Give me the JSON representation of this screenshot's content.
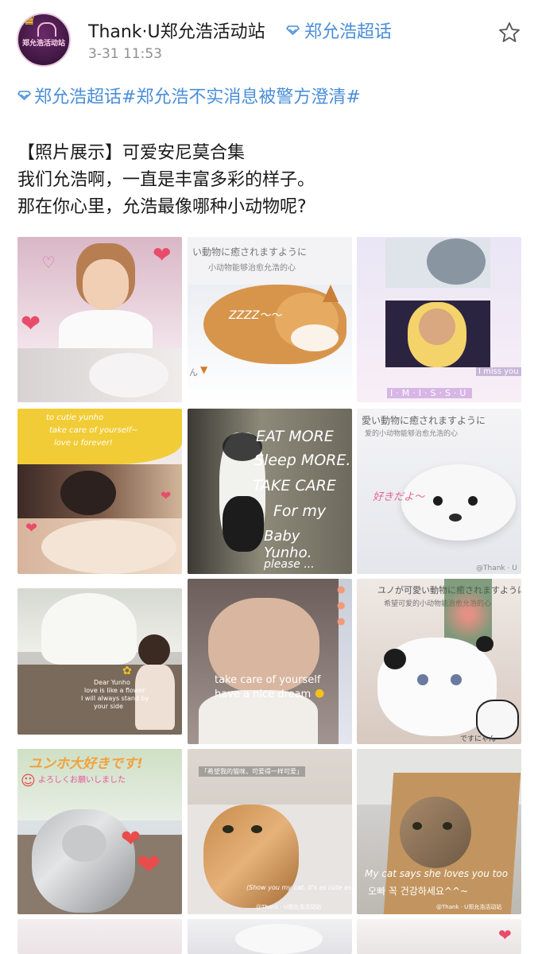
{
  "post": {
    "author": "Thank·U郑允浩活动站",
    "super_topic": "郑允浩超话",
    "time": "3-31 11:53",
    "topic_line": "郑允浩超话#郑允浩不实消息被警方澄清#",
    "body_lines": [
      "【照片展示】可爱安尼莫合集",
      "我们允浩啊，一直是丰富多彩的样子。",
      "那在你心里，允浩最像哪种小动物呢?"
    ],
    "icons": {
      "avatar": "avatar-crown-bunny",
      "star": "star-outline-icon",
      "super_topic": "diamond-icon"
    },
    "avatar_text": "郑允浩活动站"
  },
  "photos": {
    "p2": {
      "jp": "い動物に癒されますように",
      "cn": "小动物能够治愈允浩的心",
      "zzz": "ZZZZ～～",
      "tag": "ん"
    },
    "p3": {
      "miss": "I miss you",
      "letters": "I·M·I·S·S·U"
    },
    "p4": {
      "lines": [
        "to cutie yunho",
        "take care of yourself~",
        "love u forever!"
      ]
    },
    "p5": {
      "lines": [
        "EAT MORE",
        "Sleep MORE.",
        "TAKE CARE",
        "For my",
        "Baby Yunho.",
        "please ..."
      ]
    },
    "p6": {
      "jp": "愛い動物に癒されますように",
      "cn": "爱的小动物能够治愈允浩的心",
      "side": "好きだよ～",
      "wm": "@Thank · U"
    },
    "p7": {
      "lines": [
        "Dear Yunho",
        "love is like a flower",
        "I will always stand by",
        "your side"
      ]
    },
    "p8": {
      "lines": [
        "take care of yourself",
        "have a nice dream"
      ]
    },
    "p9": {
      "jp": "ユノが可愛い動物に癒されますように",
      "cn": "希望可爱的小动物能治愈允浩的心",
      "bottom": "ですにゃん"
    },
    "p10": {
      "top": "ユンホ大好きです!",
      "sub": "よろしくお願いしました"
    },
    "p11": {
      "top": "「希望我的猫咪，可爱得一样可爱」",
      "caption": "(Show you my cat, it's as cute as you.)",
      "wm": "@Thank · U郑允浩活动站"
    },
    "p12": {
      "line1": "My cat says she loves you too",
      "line2": "오빠 꼭 건강하세요^^~",
      "wm": "@Thank · U郑允浩活动站"
    }
  }
}
